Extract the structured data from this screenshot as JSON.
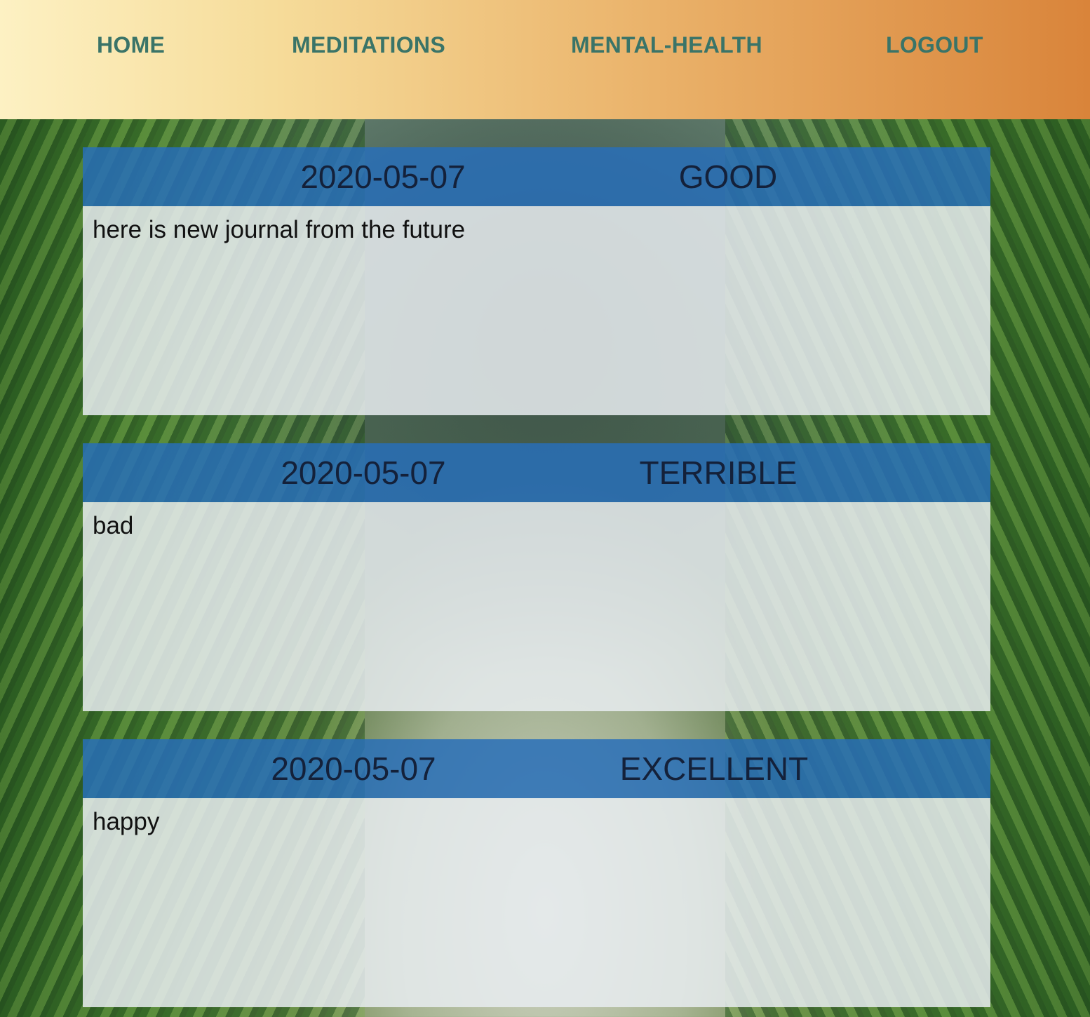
{
  "nav": {
    "home": "HOME",
    "meditations": "MEDITATIONS",
    "mental_health": "MENTAL-HEALTH",
    "logout": "LOGOUT"
  },
  "colors": {
    "nav_link": "#3a7468",
    "card_header": "#286eb9",
    "card_body": "#e8ecf0"
  },
  "journals": [
    {
      "date": "2020-05-07",
      "mood": "GOOD",
      "text": "here is new journal from the future"
    },
    {
      "date": "2020-05-07",
      "mood": "TERRIBLE",
      "text": "bad"
    },
    {
      "date": "2020-05-07",
      "mood": "EXCELLENT",
      "text": "happy"
    }
  ]
}
